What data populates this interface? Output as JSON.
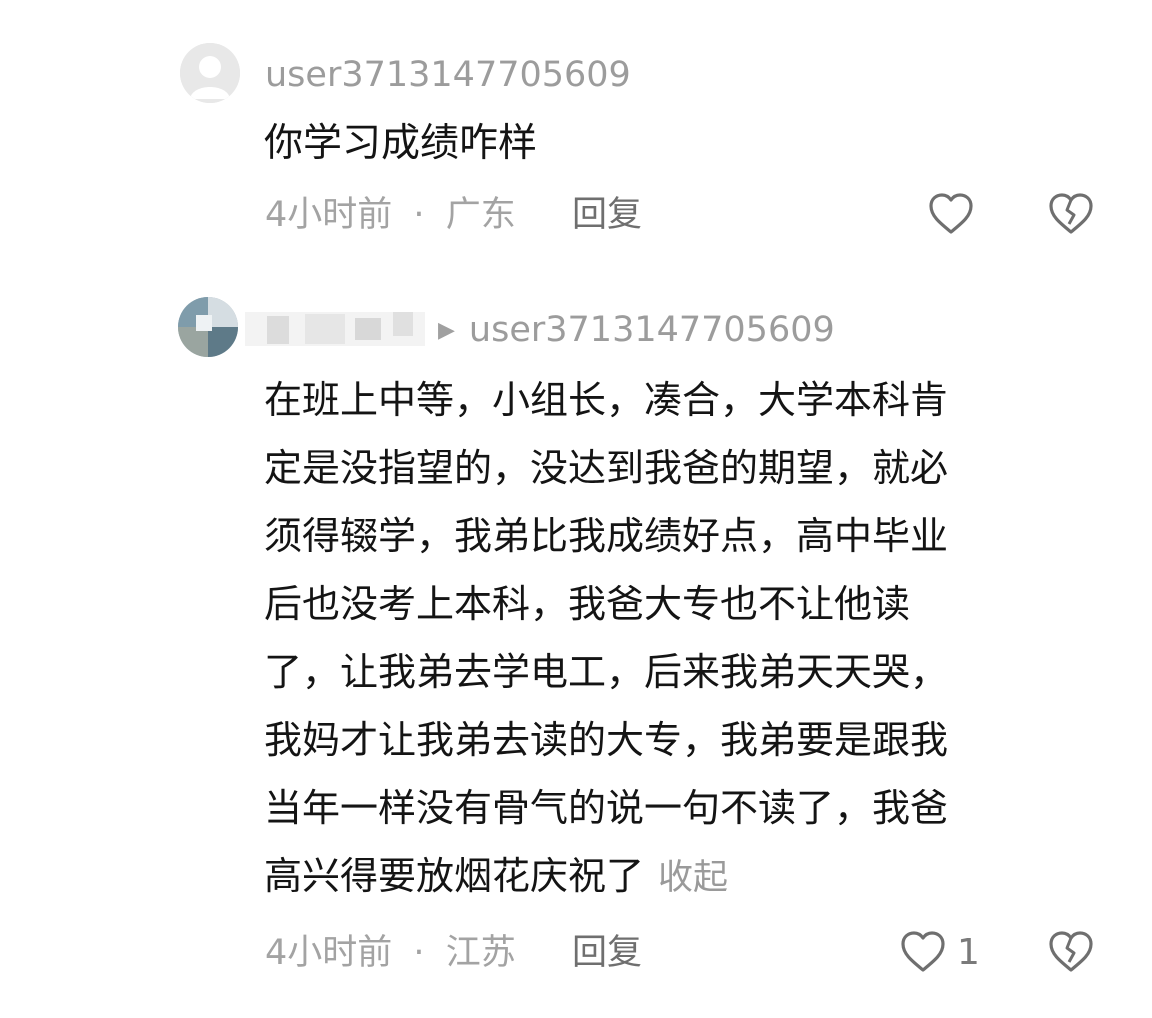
{
  "comments": [
    {
      "username": "user3713147705609",
      "text": "你学习成绩咋样",
      "time": "4小时前",
      "separator": "·",
      "location": "广东",
      "reply_label": "回复",
      "like_icon": "heart-outline-icon",
      "dislike_icon": "broken-heart-icon"
    },
    {
      "reply_arrow": "▶",
      "reply_to": "user3713147705609",
      "text_lines": [
        "在班上中等，小组长，凑合，大学本科肯",
        "定是没指望的，没达到我爸的期望，就必",
        "须得辍学，我弟比我成绩好点，高中毕业",
        "后也没考上本科，我爸大专也不让他读",
        "了，让我弟去学电工，后来我弟天天哭，",
        "我妈才让我弟去读的大专，我弟要是跟我",
        "当年一样没有骨气的说一句不读了，我爸",
        "高兴得要放烟花庆祝了"
      ],
      "collapse_label": "收起",
      "time": "4小时前",
      "separator": "·",
      "location": "江苏",
      "reply_label": "回复",
      "like_count": "1",
      "like_icon": "heart-outline-icon",
      "dislike_icon": "broken-heart-icon"
    }
  ],
  "colors": {
    "text_primary": "#141414",
    "text_secondary": "#a3a3a3",
    "icon": "#6f6f6f"
  }
}
